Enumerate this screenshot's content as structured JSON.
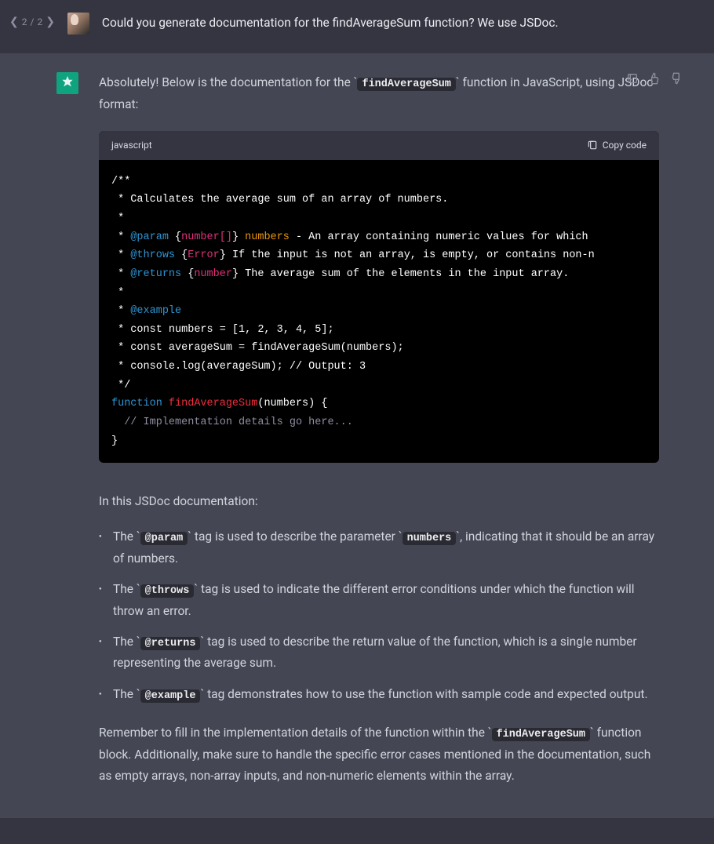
{
  "user": {
    "pagination": {
      "current": "2",
      "total": "2"
    },
    "message": "Could you generate documentation for the findAverageSum function? We use JSDoc."
  },
  "assistant": {
    "intro_before_code": "Absolutely! Below is the documentation for the ",
    "intro_code": "findAverageSum",
    "intro_after_code": " function in JavaScript, using JSDoc format:",
    "code": {
      "language": "javascript",
      "copy_label": "Copy code",
      "lines": {
        "l1": "/**",
        "l2": " * Calculates the average sum of an array of numbers.",
        "l3": " *",
        "l4_prefix": " * ",
        "l4_tag": "@param",
        "l4_brace1": " {",
        "l4_type": "number[]",
        "l4_brace2": "} ",
        "l4_name": "numbers",
        "l4_rest": " - An array containing numeric values for which ",
        "l5_prefix": " * ",
        "l5_tag": "@throws",
        "l5_brace1": " {",
        "l5_type": "Error",
        "l5_rest": "} If the input is not an array, is empty, or contains non-n",
        "l6_prefix": " * ",
        "l6_tag": "@returns",
        "l6_brace1": " {",
        "l6_type": "number",
        "l6_rest": "} The average sum of the elements in the input array.",
        "l7": " *",
        "l8_prefix": " * ",
        "l8_tag": "@example",
        "l9": " * const numbers = [1, 2, 3, 4, 5];",
        "l10": " * const averageSum = findAverageSum(numbers);",
        "l11": " * console.log(averageSum); // Output: 3",
        "l12": " */",
        "l13_kw": "function",
        "l13_sp": " ",
        "l13_fn": "findAverageSum",
        "l13_rest": "(numbers) {",
        "l14_indent": "  ",
        "l14_comment": "// Implementation details go here...",
        "l15": "}"
      }
    },
    "explain_heading": "In this JSDoc documentation:",
    "bullets": [
      {
        "before": "The ",
        "code": "@param",
        "after_a": " tag is used to describe the parameter ",
        "code2": "numbers",
        "after_b": ", indicating that it should be an array of numbers."
      },
      {
        "before": "The ",
        "code": "@throws",
        "after_a": " tag is used to indicate the different error conditions under which the function will throw an error."
      },
      {
        "before": "The ",
        "code": "@returns",
        "after_a": " tag is used to describe the return value of the function, which is a single number representing the average sum."
      },
      {
        "before": "The ",
        "code": "@example",
        "after_a": " tag demonstrates how to use the function with sample code and expected output."
      }
    ],
    "closing_before": "Remember to fill in the implementation details of the function within the ",
    "closing_code": "findAverageSum",
    "closing_after": " function block. Additionally, make sure to handle the specific error cases mentioned in the documentation, such as empty arrays, non-array inputs, and non-numeric elements within the array."
  }
}
